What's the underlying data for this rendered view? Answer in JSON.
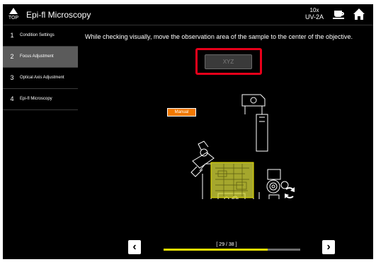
{
  "topbar": {
    "top_label": "TOP",
    "title": "Epi-fl Microscopy",
    "objective": {
      "magnification": "10x",
      "filter_cube": "UV-2A"
    },
    "icons": {
      "top": "top-icon",
      "break": "coffee-cup-icon",
      "home": "home-icon"
    }
  },
  "sidebar": {
    "items": [
      {
        "num": "1",
        "label": "Condition Settings",
        "active": false
      },
      {
        "num": "2",
        "label": "Focus Adjustment",
        "active": true
      },
      {
        "num": "3",
        "label": "Optical Axis Adjustment",
        "active": false
      },
      {
        "num": "4",
        "label": "Epi-fl Microscopy",
        "active": false
      }
    ]
  },
  "main": {
    "instruction": "While checking visually, move the observation area of the sample to the center of the objective.",
    "xyz_button": "XYZ",
    "mode_badge": "Manual",
    "pager": {
      "text": "[ 29 / 38 ]",
      "current": 29,
      "total": 38
    }
  },
  "colors": {
    "highlight": "#e8001a",
    "badge": "#f07800",
    "progress": "#e8e000",
    "stage_highlight": "#d4d63a"
  }
}
